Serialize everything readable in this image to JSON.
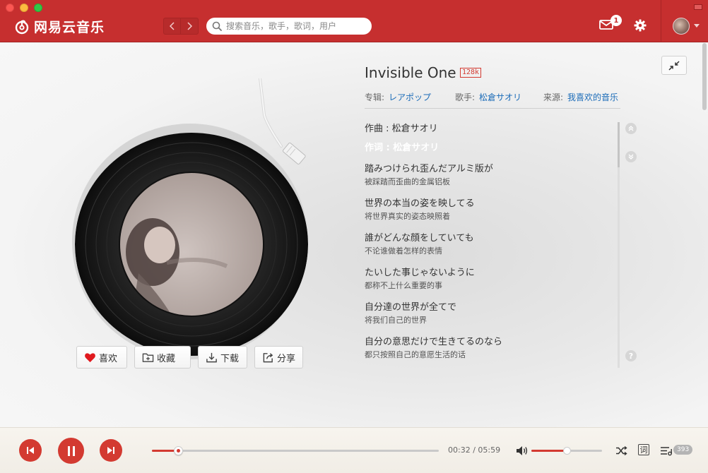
{
  "app": {
    "name": "网易云音乐"
  },
  "header": {
    "search_placeholder": "搜索音乐，歌手，歌词，用户",
    "mail_badge": "1",
    "nav_back_icon": "chevron-left-icon",
    "nav_forward_icon": "chevron-right-icon"
  },
  "song": {
    "title": "Invisible One",
    "quality": "128k",
    "album_label": "专辑:",
    "album": "レアポップ",
    "artist_label": "歌手:",
    "artist": "松倉サオリ",
    "source_label": "来源:",
    "source": "我喜欢的音乐"
  },
  "actions": {
    "like": "喜欢",
    "collect": "收藏",
    "download": "下载",
    "share": "分享"
  },
  "lyrics": {
    "composer": "作曲 : 松倉サオリ",
    "lyricist": "作词 : 松倉サオリ",
    "lines": [
      {
        "original": "踏みつけられ歪んだアルミ版が",
        "translation": "被踩踏而歪曲的金属铝板"
      },
      {
        "original": "世界の本当の姿を映してる",
        "translation": "将世界真实的姿态映照着"
      },
      {
        "original": "誰がどんな顔をしていても",
        "translation": "不论谁做着怎样的表情"
      },
      {
        "original": "たいした事じゃないように",
        "translation": "都称不上什么重要的事"
      },
      {
        "original": "自分達の世界が全てで",
        "translation": "将我们自己的世界"
      },
      {
        "original": "自分の意思だけで生きてるのなら",
        "translation": "都只按照自己的意愿生活的话"
      }
    ],
    "help": "?"
  },
  "player": {
    "current_time": "00:32",
    "total_time": "05:59",
    "time_sep": " / ",
    "progress": 0.09,
    "volume": 0.5,
    "lyric_toggle": "词",
    "playlist_count": "393"
  },
  "colors": {
    "brand_red": "#c62f2f",
    "accent_red": "#d33a31",
    "link_blue": "#1a6bb8"
  }
}
